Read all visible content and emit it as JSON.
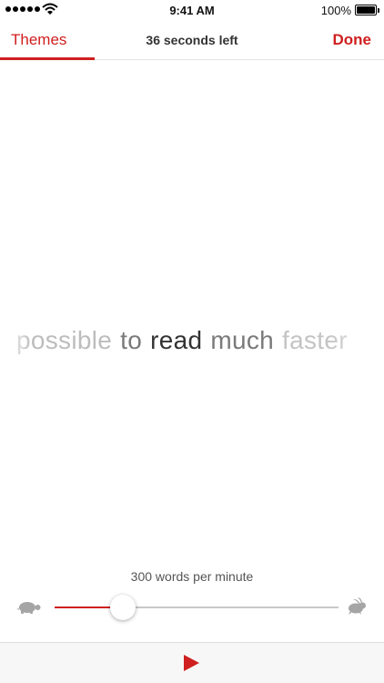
{
  "status_bar": {
    "time": "9:41 AM",
    "battery": "100%",
    "signal_icon": "signal-dots-icon",
    "wifi_icon": "wifi-icon",
    "battery_icon": "battery-icon"
  },
  "nav": {
    "left_label": "Themes",
    "title": "36 seconds left",
    "right_label": "Done"
  },
  "reader": {
    "words": [
      "possible",
      "to",
      "read",
      "much",
      "faster"
    ]
  },
  "speed": {
    "label": "300 words per minute",
    "slider_value": 0.24,
    "slow_icon": "turtle-icon",
    "fast_icon": "rabbit-icon"
  },
  "controls": {
    "play_icon": "play-icon"
  },
  "colors": {
    "accent": "#cf1f1f",
    "focus_word": "#333333",
    "faded_word": "#bdbdbd"
  }
}
